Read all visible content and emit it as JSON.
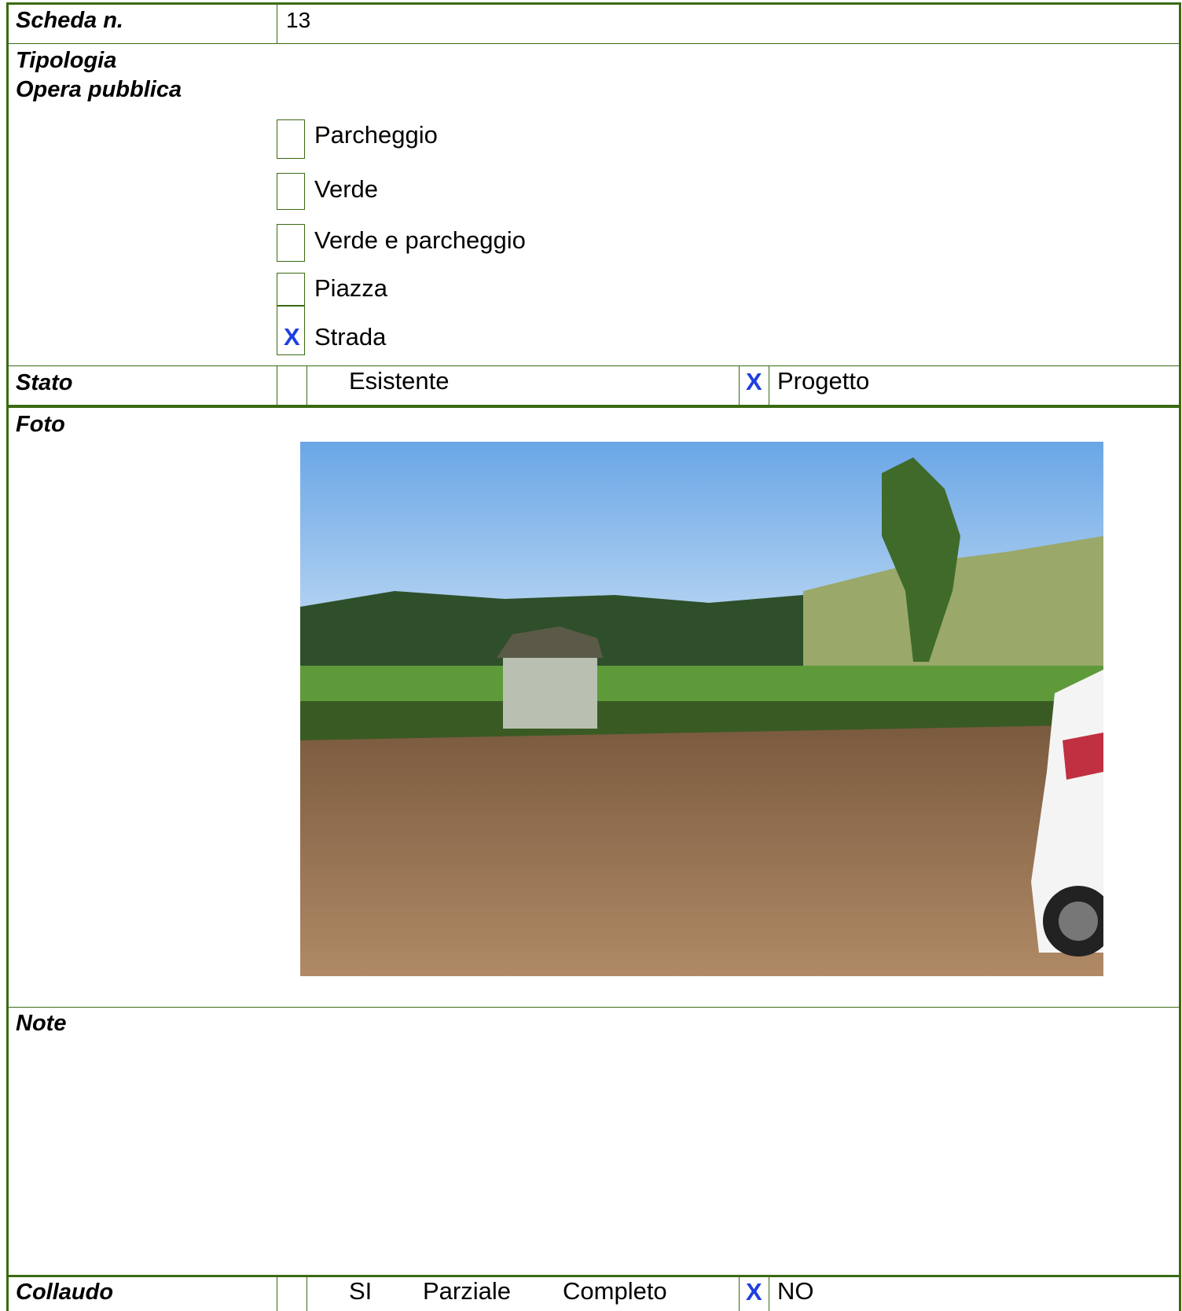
{
  "header": {
    "label": "Scheda n.",
    "value": "13"
  },
  "tipologia": {
    "label_line1": "Tipologia",
    "label_line2": "Opera pubblica",
    "options": [
      {
        "label": "Parcheggio",
        "mark": ""
      },
      {
        "label": "Verde",
        "mark": ""
      },
      {
        "label": "Verde e parcheggio",
        "mark": ""
      },
      {
        "label": "Piazza",
        "mark": ""
      },
      {
        "label": "Strada",
        "mark": "X"
      }
    ]
  },
  "stato": {
    "label": "Stato",
    "option1": {
      "label": "Esistente",
      "mark": ""
    },
    "option2": {
      "label": "Progetto",
      "mark": "X"
    }
  },
  "foto": {
    "label": "Foto"
  },
  "note": {
    "label": "Note",
    "value": ""
  },
  "collaudo": {
    "label": "Collaudo",
    "si": "SI",
    "parziale": "Parziale",
    "completo": "Completo",
    "no": {
      "label": "NO",
      "mark": "X"
    }
  },
  "colors": {
    "border": "#3a6b12",
    "mark": "#1f3fe0"
  }
}
